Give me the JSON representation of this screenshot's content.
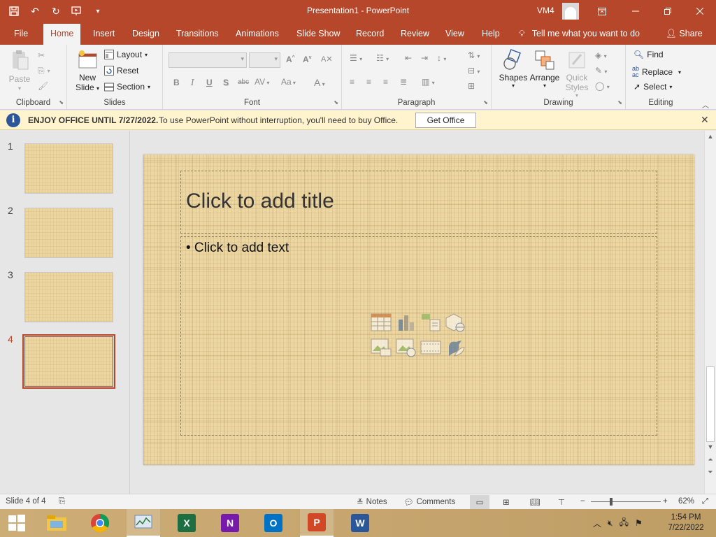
{
  "window": {
    "title": "Presentation1  -  PowerPoint",
    "user": "VM4"
  },
  "tabs": [
    "File",
    "Home",
    "Insert",
    "Design",
    "Transitions",
    "Animations",
    "Slide Show",
    "Record",
    "Review",
    "View",
    "Help"
  ],
  "tell_me": "Tell me what you want to do",
  "share": "Share",
  "ribbon": {
    "clipboard": {
      "label": "Clipboard",
      "paste": "Paste"
    },
    "slides": {
      "label": "Slides",
      "new_slide_line1": "New",
      "new_slide_line2": "Slide",
      "layout": "Layout",
      "reset": "Reset",
      "section": "Section"
    },
    "font": {
      "label": "Font",
      "bold": "B",
      "italic": "I",
      "underline": "U",
      "shadow": "S",
      "strike": "abc",
      "spacing": "AV",
      "case": "Aa",
      "color": "A"
    },
    "paragraph": {
      "label": "Paragraph"
    },
    "drawing": {
      "label": "Drawing",
      "shapes": "Shapes",
      "arrange": "Arrange",
      "quick_styles_line1": "Quick",
      "quick_styles_line2": "Styles"
    },
    "editing": {
      "label": "Editing",
      "find": "Find",
      "replace": "Replace",
      "select": "Select"
    }
  },
  "message_bar": {
    "bold": "ENJOY OFFICE UNTIL 7/27/2022.",
    "text": "To use PowerPoint without interruption, you'll need to buy Office.",
    "button": "Get Office"
  },
  "thumbnails": [
    {
      "number": "1",
      "selected": false
    },
    {
      "number": "2",
      "selected": false
    },
    {
      "number": "3",
      "selected": false
    },
    {
      "number": "4",
      "selected": true
    }
  ],
  "slide": {
    "title_placeholder": "Click to add title",
    "body_placeholder": "• Click to add text"
  },
  "status": {
    "slide_info": "Slide 4 of 4",
    "notes": "Notes",
    "comments": "Comments",
    "zoom": "62%"
  },
  "taskbar": {
    "time": "1:54 PM",
    "date": "7/22/2022"
  },
  "colors": {
    "accent": "#b7472a",
    "slide_bg": "#ecd6a2",
    "message_bar": "#fff4ce"
  }
}
